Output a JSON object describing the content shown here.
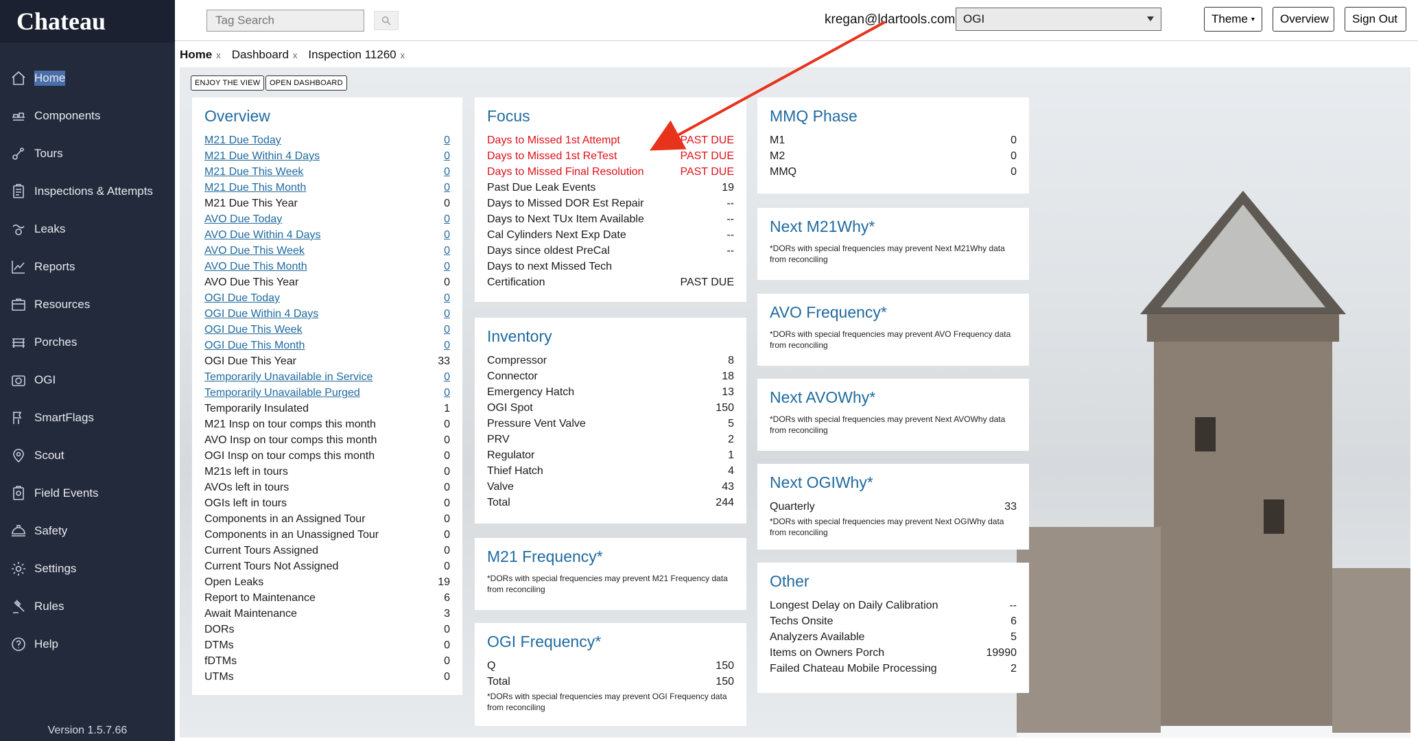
{
  "brand": "Chateau",
  "sidebar": {
    "items": [
      {
        "label": "Home",
        "icon": "home-icon"
      },
      {
        "label": "Components",
        "icon": "components-icon"
      },
      {
        "label": "Tours",
        "icon": "tours-icon"
      },
      {
        "label": "Inspections & Attempts",
        "icon": "clipboard-icon"
      },
      {
        "label": "Leaks",
        "icon": "leaks-icon"
      },
      {
        "label": "Reports",
        "icon": "chart-icon"
      },
      {
        "label": "Resources",
        "icon": "resources-icon"
      },
      {
        "label": "Porches",
        "icon": "porches-icon"
      },
      {
        "label": "OGI",
        "icon": "camera-icon"
      },
      {
        "label": "SmartFlags",
        "icon": "flags-icon"
      },
      {
        "label": "Scout",
        "icon": "scout-icon"
      },
      {
        "label": "Field Events",
        "icon": "field-events-icon"
      },
      {
        "label": "Safety",
        "icon": "safety-icon"
      },
      {
        "label": "Settings",
        "icon": "gear-icon"
      },
      {
        "label": "Rules",
        "icon": "gavel-icon"
      },
      {
        "label": "Help",
        "icon": "help-icon"
      }
    ],
    "version": "Version 1.5.7.66"
  },
  "topbar": {
    "search_placeholder": "Tag Search",
    "user_email": "kregan@ldartools.com",
    "org_selected": "OGI",
    "theme_label": "Theme",
    "overview_label": "Overview",
    "signout_label": "Sign Out"
  },
  "tabs": [
    {
      "label": "Home",
      "close": "x"
    },
    {
      "label": "Dashboard",
      "close": "x"
    },
    {
      "label": "Inspection 11260",
      "close": "x"
    }
  ],
  "buttons": {
    "enjoy": "ENJOY THE VIEW",
    "open_dashboard": "OPEN DASHBOARD"
  },
  "overview": {
    "title": "Overview",
    "rows": [
      {
        "label": "M21 Due Today",
        "value": "0"
      },
      {
        "label": "M21 Due Within 4 Days",
        "value": "0"
      },
      {
        "label": "M21 Due This Week",
        "value": "0"
      },
      {
        "label": "M21 Due This Month",
        "value": "0"
      },
      {
        "label": "M21 Due This Year",
        "value": "0"
      },
      {
        "label": "AVO Due Today",
        "value": "0"
      },
      {
        "label": "AVO Due Within 4 Days",
        "value": "0"
      },
      {
        "label": "AVO Due This Week",
        "value": "0"
      },
      {
        "label": "AVO Due This Month",
        "value": "0"
      },
      {
        "label": "AVO Due This Year",
        "value": "0"
      },
      {
        "label": "OGI Due Today",
        "value": "0"
      },
      {
        "label": "OGI Due Within 4 Days",
        "value": "0"
      },
      {
        "label": "OGI Due This Week",
        "value": "0"
      },
      {
        "label": "OGI Due This Month",
        "value": "0"
      },
      {
        "label": "OGI Due This Year",
        "value": "33"
      },
      {
        "label": "Temporarily Unavailable in Service",
        "value": "0"
      },
      {
        "label": "Temporarily Unavailable Purged",
        "value": "0"
      },
      {
        "label": "Temporarily Insulated",
        "value": "1"
      },
      {
        "label": "M21 Insp on tour comps this month",
        "value": "0"
      },
      {
        "label": "AVO Insp on tour comps this month",
        "value": "0"
      },
      {
        "label": "OGI Insp on tour comps this month",
        "value": "0"
      },
      {
        "label": "M21s left in tours",
        "value": "0"
      },
      {
        "label": "AVOs left in tours",
        "value": "0"
      },
      {
        "label": "OGIs left in tours",
        "value": "0"
      },
      {
        "label": "Components in an Assigned Tour",
        "value": "0"
      },
      {
        "label": "Components in an Unassigned Tour",
        "value": "0"
      },
      {
        "label": "Current Tours Assigned",
        "value": "0"
      },
      {
        "label": "Current Tours Not Assigned",
        "value": "0"
      },
      {
        "label": "Open Leaks",
        "value": "19"
      },
      {
        "label": "Report to Maintenance",
        "value": "6"
      },
      {
        "label": "Await Maintenance",
        "value": "3"
      },
      {
        "label": "DORs",
        "value": "0"
      },
      {
        "label": "DTMs",
        "value": "0"
      },
      {
        "label": "fDTMs",
        "value": "0"
      },
      {
        "label": "UTMs",
        "value": "0"
      }
    ]
  },
  "focus": {
    "title": "Focus",
    "rows": [
      {
        "label": "Days to Missed 1st Attempt",
        "value": "PAST DUE"
      },
      {
        "label": "Days to Missed 1st ReTest",
        "value": "PAST DUE"
      },
      {
        "label": "Days to Missed Final Resolution",
        "value": "PAST DUE"
      },
      {
        "label": "Past Due Leak Events",
        "value": "19"
      },
      {
        "label": "Days to Missed DOR Est Repair",
        "value": "--"
      },
      {
        "label": "Days to Next TUx Item Available",
        "value": "--"
      },
      {
        "label": "Cal Cylinders Next Exp Date",
        "value": "--"
      },
      {
        "label": "Days since oldest PreCal",
        "value": "--"
      },
      {
        "label": "Days to next Missed Tech",
        "value": ""
      },
      {
        "label": "Certification",
        "value": "PAST DUE"
      }
    ]
  },
  "inventory": {
    "title": "Inventory",
    "rows": [
      {
        "label": "Compressor",
        "value": "8"
      },
      {
        "label": "Connector",
        "value": "18"
      },
      {
        "label": "Emergency Hatch",
        "value": "13"
      },
      {
        "label": "OGI Spot",
        "value": "150"
      },
      {
        "label": "Pressure Vent Valve",
        "value": "5"
      },
      {
        "label": "PRV",
        "value": "2"
      },
      {
        "label": "Regulator",
        "value": "1"
      },
      {
        "label": "Thief Hatch",
        "value": "4"
      },
      {
        "label": "Valve",
        "value": "43"
      },
      {
        "label": "Total",
        "value": "244"
      }
    ]
  },
  "m21_frequency": {
    "title": "M21 Frequency*",
    "note": "*DORs with special frequencies may prevent M21 Frequency data from reconciling"
  },
  "ogi_frequency": {
    "title": "OGI Frequency*",
    "rows": [
      {
        "label": "Q",
        "value": "150"
      },
      {
        "label": "Total",
        "value": "150"
      }
    ],
    "note": "*DORs with special frequencies may prevent OGI Frequency data from reconciling"
  },
  "mmq": {
    "title": "MMQ Phase",
    "rows": [
      {
        "label": "M1",
        "value": "0"
      },
      {
        "label": "M2",
        "value": "0"
      },
      {
        "label": "MMQ",
        "value": "0"
      }
    ]
  },
  "m21_why": {
    "title": "Next M21Why*",
    "note": "*DORs with special frequencies may prevent Next M21Why data from reconciling"
  },
  "avo_frequency": {
    "title": "AVO Frequency*",
    "note": "*DORs with special frequencies may prevent AVO Frequency data from reconciling"
  },
  "avo_why": {
    "title": "Next AVOWhy*",
    "note": "*DORs with special frequencies may prevent Next AVOWhy data from reconciling"
  },
  "ogi_why": {
    "title": "Next OGIWhy*",
    "rows": [
      {
        "label": "Quarterly",
        "value": "33"
      }
    ],
    "note": "*DORs with special frequencies may prevent Next OGIWhy data from reconciling"
  },
  "other": {
    "title": "Other",
    "rows": [
      {
        "label": "Longest Delay on Daily Calibration",
        "value": "--"
      },
      {
        "label": "Techs Onsite",
        "value": "6"
      },
      {
        "label": "Analyzers Available",
        "value": "5"
      },
      {
        "label": "Items on Owners Porch",
        "value": "19990"
      },
      {
        "label": "Failed Chateau Mobile Processing",
        "value": "2"
      }
    ]
  },
  "colors": {
    "sidebar_bg": "#232a3b",
    "accent_blue": "#1f6a9f",
    "alert_red": "#e0101a"
  }
}
